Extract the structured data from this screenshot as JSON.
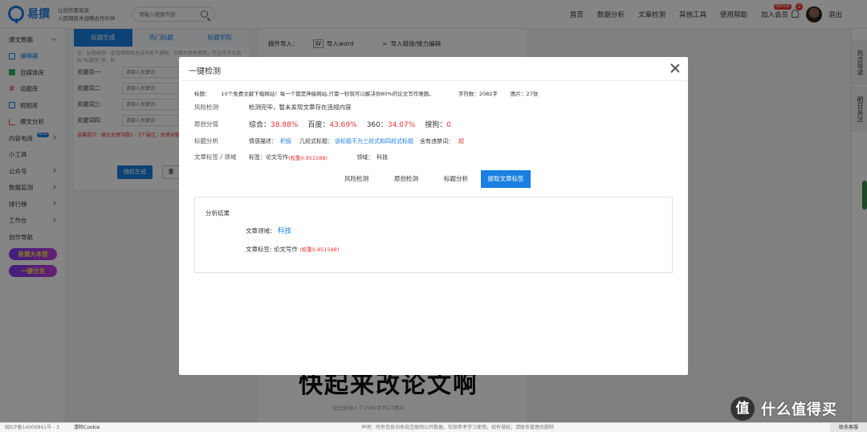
{
  "header": {
    "logo_text": "易撰",
    "slogan_line1": "让创作更高效",
    "slogan_line2": "人民网技术战略合作伙伴",
    "search_placeholder": "请输入搜索内容",
    "nav": [
      "首页",
      "数据分析",
      "文章检测",
      "其他工具",
      "使用帮助",
      "加入会员"
    ],
    "vip_badge": "限时5折",
    "notify_count": "2",
    "logout": "退出"
  },
  "sidebar": {
    "section_title": "爆文数据",
    "items": [
      {
        "label": "编辑器",
        "icon": "editor-icon",
        "color": "#1a7fe0"
      },
      {
        "label": "自媒体库",
        "icon": "media-library-icon",
        "color": "#2db36c"
      },
      {
        "label": "话题库",
        "icon": "topic-icon",
        "color": "#e24a8a"
      },
      {
        "label": "视频库",
        "icon": "video-icon",
        "color": "#1a7fe0"
      },
      {
        "label": "爆文分析",
        "icon": "analysis-icon",
        "color": "#e6392e"
      }
    ],
    "groups": [
      {
        "label": "内容电商",
        "tag": "NEW"
      },
      {
        "label": "小工具"
      },
      {
        "label": "公众号"
      },
      {
        "label": "数据监测"
      },
      {
        "label": "排行榜"
      },
      {
        "label": "工作台"
      },
      {
        "label": "创作导航"
      }
    ],
    "pills": [
      "易撰大本营",
      "一键分发"
    ]
  },
  "editor": {
    "tabs": [
      "标题生成",
      "热门标题",
      "标题学院"
    ],
    "hint": "注：标题按照一定规律随机生成可能不通顺，仅做为参考使用，不过可于五指标\"标题技\"进，好",
    "keyword_labels": [
      "关键词一:",
      "关键词二:",
      "关键词三:",
      "关键词四:"
    ],
    "keyword_placeholder": "请输入关键词",
    "warning": "温馨提示：建议关键词数2 - 3个最佳，关键词量越少，但越符合您的需求",
    "generate_button": "随机生成",
    "reset_button": "重",
    "import_label": "稿件导入：",
    "import_word": "导入word",
    "import_link": "导入链接/接力编辑",
    "article_title_visible": "快起来改论文啊",
    "word_count_text": "您已经输入了2082字符27图片"
  },
  "right_rail": [
    "热点导读",
    "明日关注"
  ],
  "footer": {
    "icp": "闽ICP备14006861号 - 3",
    "clear_cookie": "清除Cookie",
    "disclaimer": "声明：所有信息均来自互联网公开数据，仅供参考学习使用，如有侵权，请联系管理员删除",
    "contact": "联系客服"
  },
  "watermark": {
    "symbol": "值",
    "text": "什么值得买"
  },
  "modal": {
    "title": "一键检测",
    "article_title_label": "标题：",
    "article_title": "10个免费文献下载网站！每一个都是神级网站,只需一秒就可以解决你80%的论文写作难题。",
    "char_count": "字符数：2082字",
    "image_count": "图片：27张",
    "risk": {
      "label": "风险检测",
      "text": "检测完毕，暂未发现文章存在违规内容"
    },
    "originality": {
      "label": "原创分值",
      "items": [
        {
          "name": "综合：",
          "value": "38.88%"
        },
        {
          "name": "百度：",
          "value": "43.69%"
        },
        {
          "name": "360：",
          "value": "34.07%"
        },
        {
          "name": "搜狗：",
          "value": "0"
        }
      ]
    },
    "title_analysis": {
      "label": "标题分析",
      "emotion_label": "情感描述：",
      "emotion_value": "积极",
      "structure_label": "几段式标题：",
      "structure_value": "该标题不为三段式和四段式标题",
      "banned_label": "含有违禁词：",
      "banned_value": "超"
    },
    "tags_row": {
      "label": "文章标签 / 领域",
      "tag_label": "标签：",
      "tag_value": "论文写作",
      "tag_weight": "(权重0.851588)",
      "domain_label": "领域：",
      "domain_value": "科技"
    },
    "tabs": [
      "风险检测",
      "原创检测",
      "标题分析",
      "提取文章标签"
    ],
    "active_tab": 3,
    "result": {
      "title": "分析结果",
      "domain_label": "文章领域：",
      "domain_value": "科技",
      "tag_label": "文章标签:",
      "tag_value": "论文写作",
      "tag_weight": "(权重0.851588)"
    }
  }
}
